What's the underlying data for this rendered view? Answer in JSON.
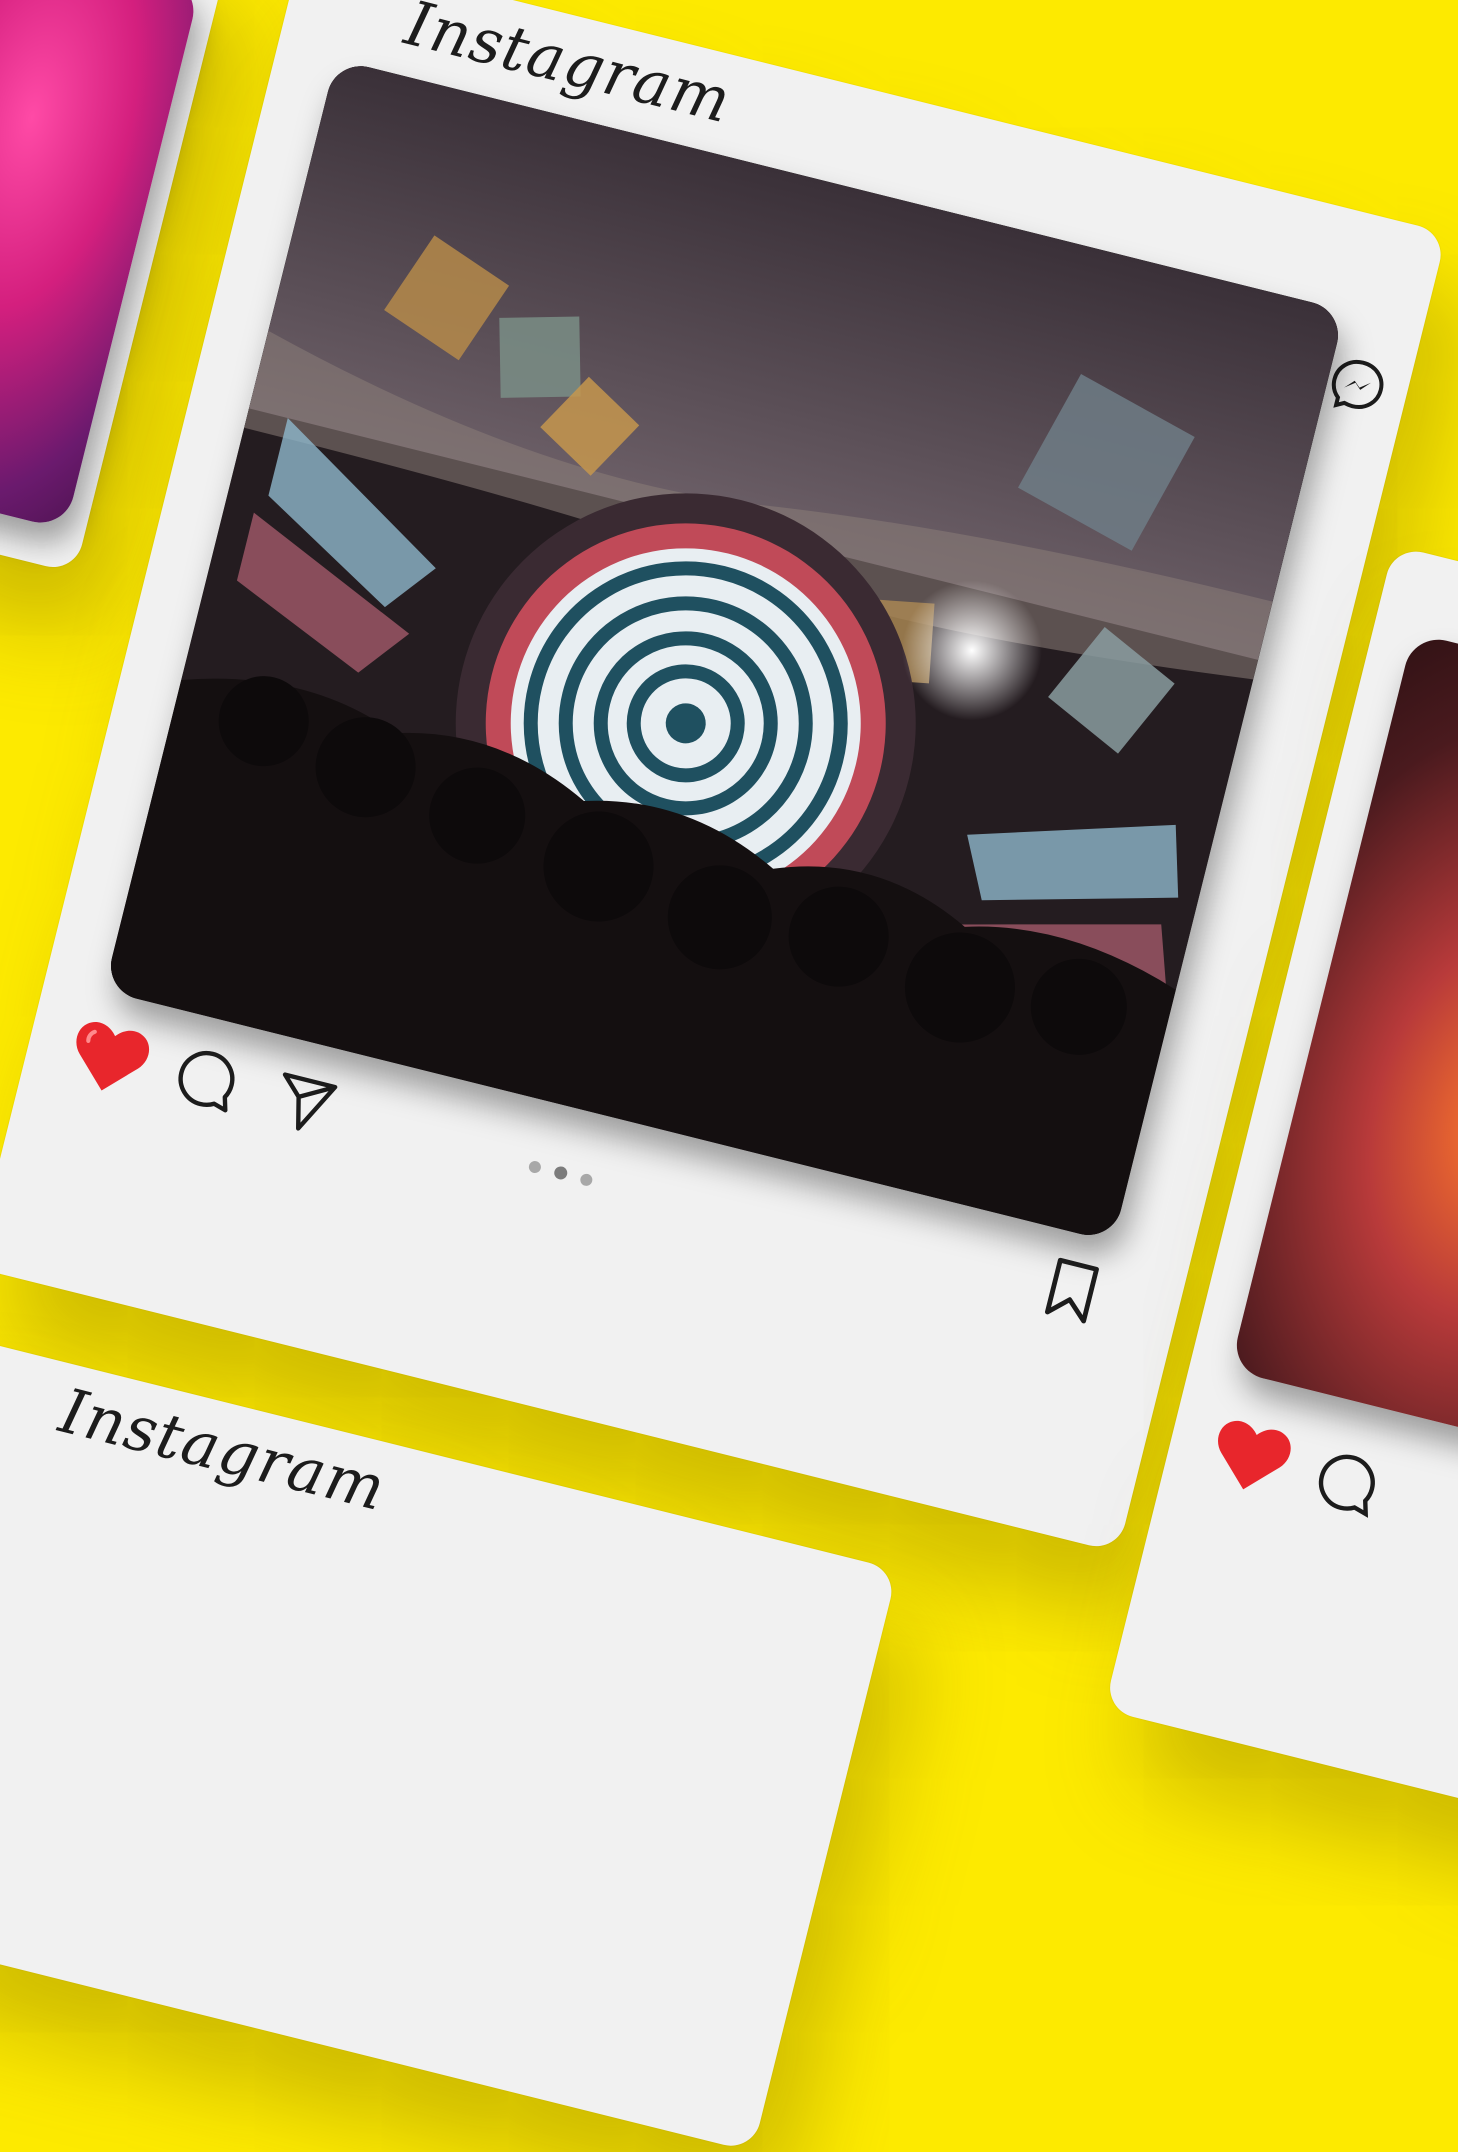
{
  "background_color": "#fdea00",
  "main_post": {
    "brand": "Instagram",
    "header_icons": [
      "heart-outline-icon",
      "messenger-icon"
    ],
    "actions": {
      "like": {
        "icon": "heart-filled-icon",
        "liked": true,
        "color": "#e8262c"
      },
      "comment": {
        "icon": "comment-icon"
      },
      "share": {
        "icon": "send-icon"
      },
      "save": {
        "icon": "bookmark-icon"
      }
    },
    "carousel": {
      "total": 3,
      "active_index": 1
    }
  },
  "bottom_post": {
    "brand": "Instagram"
  },
  "right_post": {
    "actions": {
      "like": {
        "icon": "heart-filled-icon",
        "liked": true
      }
    }
  }
}
